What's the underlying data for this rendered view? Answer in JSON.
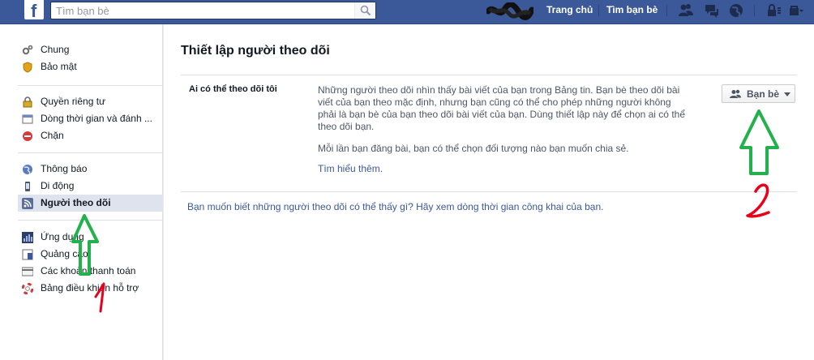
{
  "header": {
    "logo": "f",
    "search_placeholder": "Tìm bạn bè",
    "nav_home": "Trang chủ",
    "nav_find_friends": "Tìm bạn bè"
  },
  "sidebar": {
    "groups": [
      [
        {
          "label": "Chung",
          "icon": "gears-icon"
        },
        {
          "label": "Bảo mật",
          "icon": "shield-icon"
        }
      ],
      [
        {
          "label": "Quyền riêng tư",
          "icon": "lock-icon"
        },
        {
          "label": "Dòng thời gian và đánh ...",
          "icon": "timeline-icon"
        },
        {
          "label": "Chặn",
          "icon": "block-icon"
        }
      ],
      [
        {
          "label": "Thông báo",
          "icon": "globe-icon"
        },
        {
          "label": "Di động",
          "icon": "mobile-icon"
        },
        {
          "label": "Người theo dõi",
          "icon": "rss-icon",
          "selected": true
        }
      ],
      [
        {
          "label": "Ứng dụng",
          "icon": "apps-icon"
        },
        {
          "label": "Quảng cáo",
          "icon": "ads-icon"
        },
        {
          "label": "Các khoản thanh toán",
          "icon": "credit-card-icon"
        },
        {
          "label": "Bảng điều khiển hỗ trợ",
          "icon": "lifebuoy-icon"
        }
      ]
    ]
  },
  "main": {
    "title": "Thiết lập người theo dõi",
    "row_label": "Ai có thể theo dõi tôi",
    "row_description": "Những người theo dõi nhìn thấy bài viết của bạn trong Bảng tin. Bạn bè theo dõi bài viết của bạn theo mặc định, nhưng bạn cũng có thể cho phép những người không phải là bạn bè của bạn theo dõi bài viết của bạn. Dùng thiết lập này để chọn ai có thể theo dõi bạn.",
    "row_description_2": "Mỗi lần bạn đăng bài, bạn có thể chọn đối tượng nào bạn muốn chia sẻ.",
    "learn_more": "Tìm hiểu thêm.",
    "audience_button": "Bạn bè",
    "public_timeline_link": "Bạn muốn biết những người theo dõi có thể thấy gì? Hãy xem dòng thời gian công khai của bạn."
  },
  "colors": {
    "brand": "#3b5998",
    "selected_bg": "#dfe3ee",
    "annotation_green": "#22b14c",
    "annotation_red": "#e8001c"
  }
}
